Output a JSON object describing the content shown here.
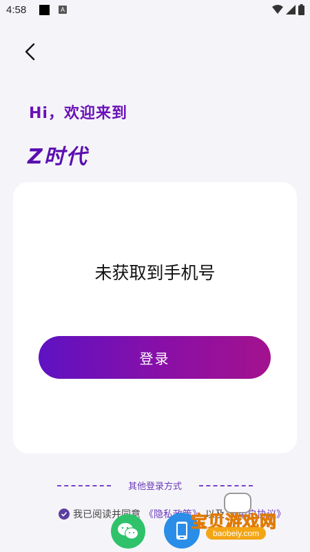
{
  "status_bar": {
    "time": "4:58",
    "notif_icon": "A"
  },
  "header": {
    "back_icon": "chevron-left-icon"
  },
  "greeting": {
    "line1": "Hi，欢迎来到",
    "brand": "Z时代"
  },
  "card": {
    "phone_status": "未获取到手机号",
    "login_label": "登录"
  },
  "other_login": {
    "label": "其他登录方式"
  },
  "agreement": {
    "prefix": "我已阅读并同意",
    "privacy_link": "《隐私政策》",
    "suffix": "以及",
    "user_link": "《用户协议》"
  },
  "watermark": {
    "title": "宝贝游戏网",
    "url": "baobeiy.com"
  },
  "colors": {
    "accent": "#6a11b8",
    "gradient_start": "#5f12c2",
    "gradient_end": "#a3128e",
    "wechat": "#2fc26a",
    "phone": "#2a8ee8"
  }
}
